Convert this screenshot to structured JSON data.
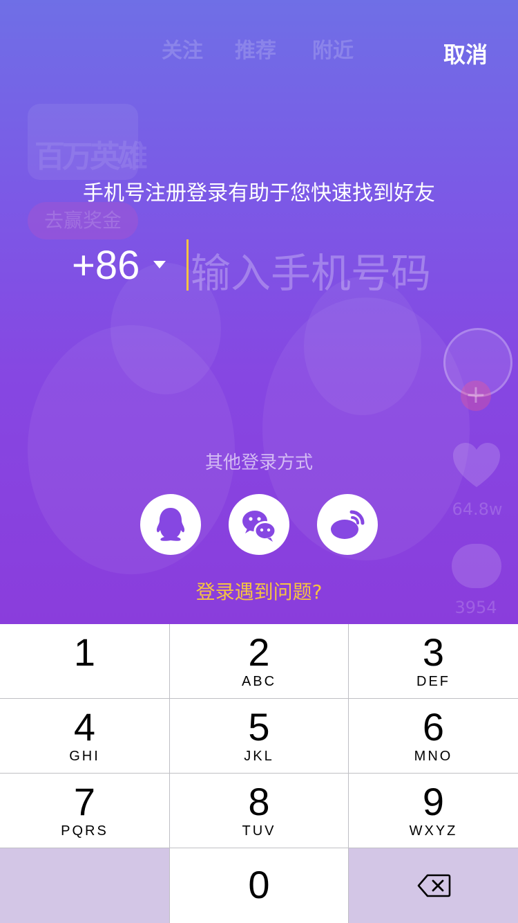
{
  "top_nav": {
    "tabs": [
      "关注",
      "推荐",
      "附近"
    ],
    "cancel_label": "取消"
  },
  "background": {
    "logo_text": "百万英雄",
    "promo_pill": "去赢奖金",
    "like_count": "64.8w",
    "comment_count": "3954"
  },
  "login": {
    "headline": "手机号注册登录有助于您快速找到好友",
    "country_code": "+86",
    "phone_placeholder": "输入手机号码",
    "other_methods_label": "其他登录方式",
    "social_icons": [
      "qq-icon",
      "wechat-icon",
      "weibo-icon"
    ],
    "problem_link": "登录遇到问题?"
  },
  "colors": {
    "accent_yellow": "#f5c342",
    "overlay_purple": "#8647e2",
    "keypad_dark_key": "#d3c6e6"
  },
  "keypad": {
    "keys": [
      {
        "num": "1",
        "letters": ""
      },
      {
        "num": "2",
        "letters": "ABC"
      },
      {
        "num": "3",
        "letters": "DEF"
      },
      {
        "num": "4",
        "letters": "GHI"
      },
      {
        "num": "5",
        "letters": "JKL"
      },
      {
        "num": "6",
        "letters": "MNO"
      },
      {
        "num": "7",
        "letters": "PQRS"
      },
      {
        "num": "8",
        "letters": "TUV"
      },
      {
        "num": "9",
        "letters": "WXYZ"
      },
      {
        "num": "0",
        "letters": ""
      }
    ]
  }
}
